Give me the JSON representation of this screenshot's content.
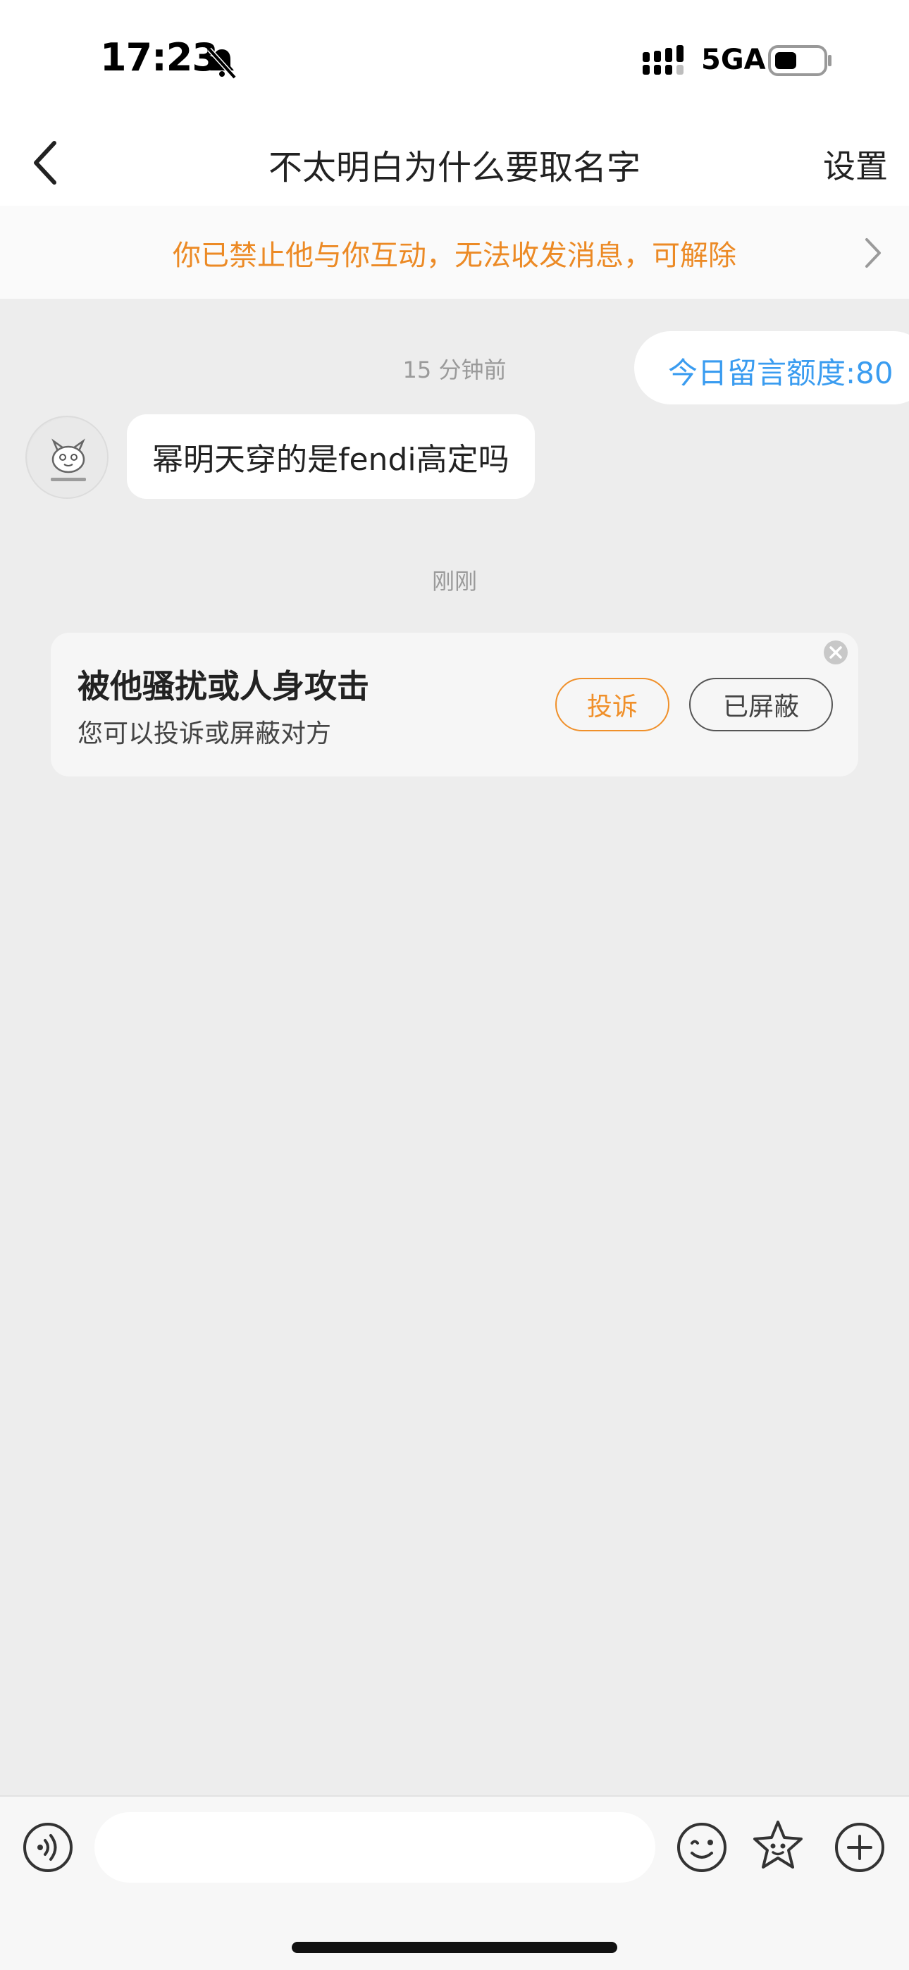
{
  "status_bar": {
    "time": "17:23",
    "network": "5GA",
    "icons": [
      "bell-slash-icon",
      "signal-icon",
      "battery-icon"
    ]
  },
  "nav": {
    "back_icon": "chevron-left-icon",
    "title": "不太明白为什么要取名字",
    "settings_label": "设置"
  },
  "notice": {
    "text": "你已禁止他与你互动，无法收发消息，可解除",
    "color": "#ec8a25",
    "chevron_icon": "chevron-right-icon"
  },
  "chat": {
    "quota_label": "今日留言额度:80",
    "quota_color": "#3a9cf0",
    "timestamp_1": "15 分钟前",
    "message_1": "幂明天穿的是fendi高定吗",
    "timestamp_2": "刚刚",
    "safety_card": {
      "title": "被他骚扰或人身攻击",
      "subtitle": "您可以投诉或屏蔽对方",
      "report_label": "投诉",
      "blocked_label": "已屏蔽",
      "close_icon": "close-circle-icon"
    }
  },
  "input_bar": {
    "placeholder": "",
    "icons": [
      "voice-icon",
      "emoji-icon",
      "sticker-icon",
      "plus-icon"
    ]
  }
}
